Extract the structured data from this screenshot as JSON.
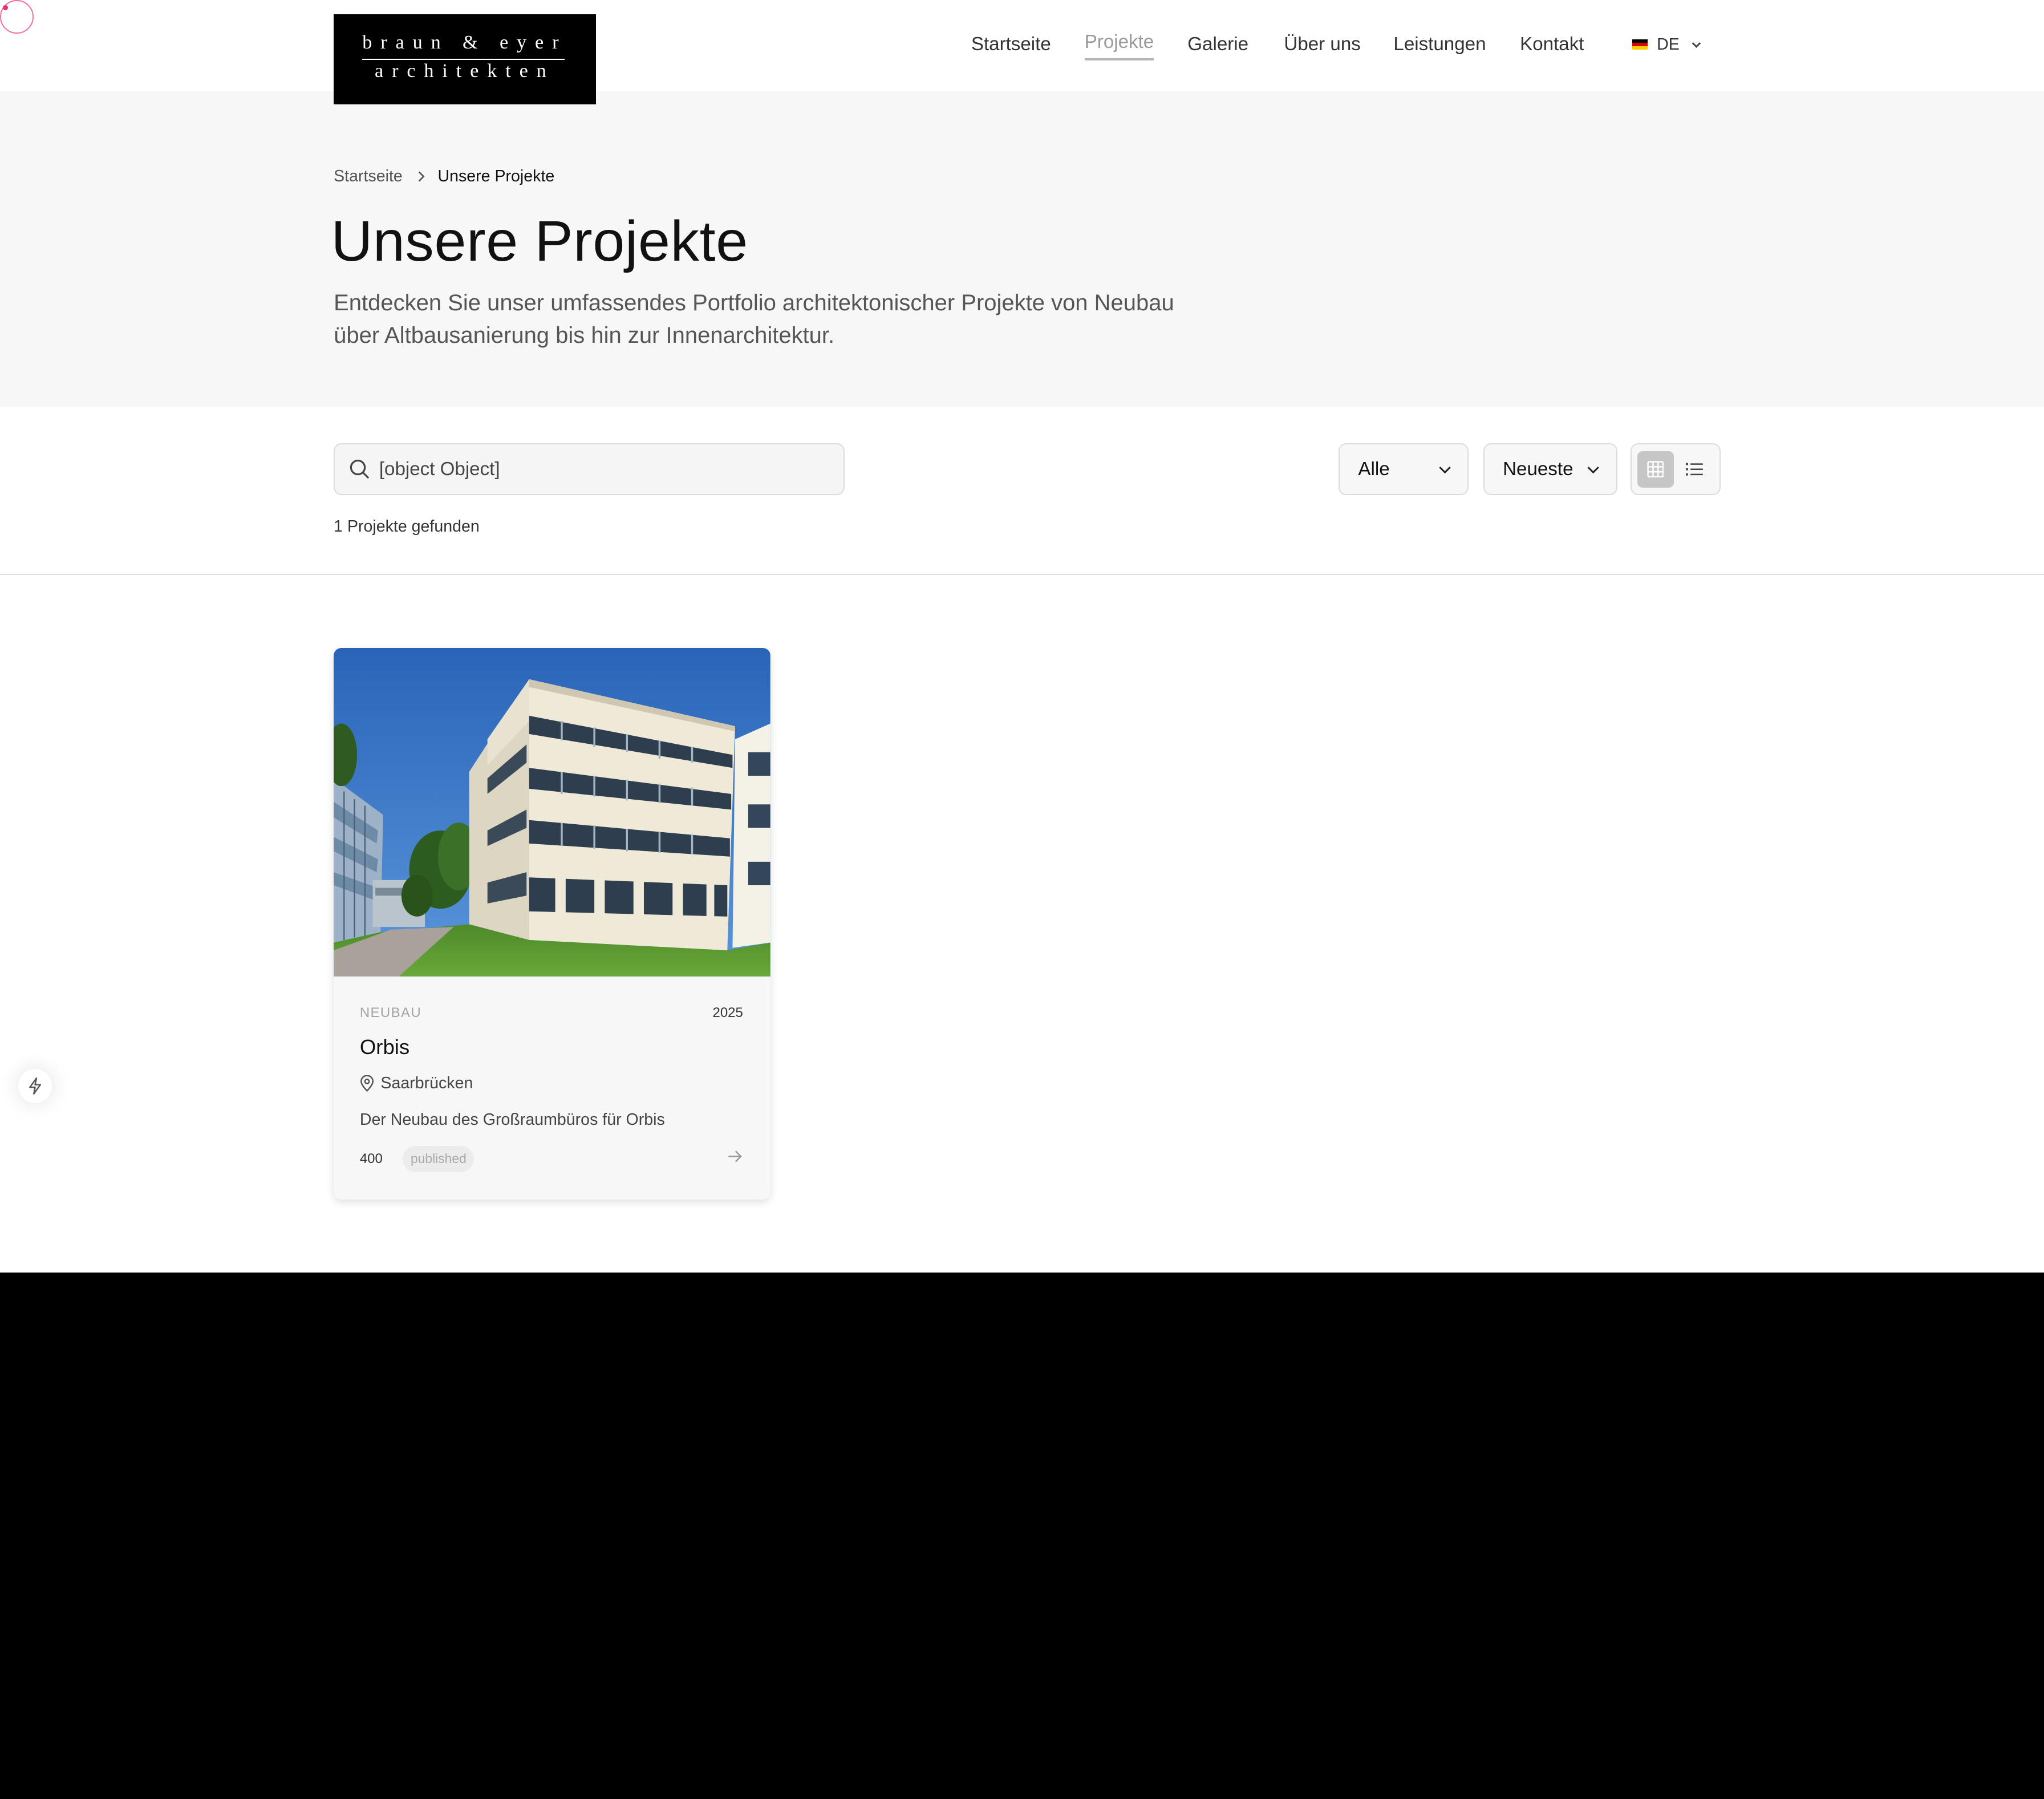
{
  "header": {
    "logo_line1": "braun & eyer",
    "logo_line2": "architekten",
    "nav": [
      "Startseite",
      "Projekte",
      "Galerie",
      "Über uns",
      "Leistungen",
      "Kontakt"
    ],
    "active_nav": "Projekte",
    "language": "DE",
    "language_flag": "flag-de-icon"
  },
  "breadcrumb": {
    "home": "Startseite",
    "current": "Unsere Projekte"
  },
  "hero": {
    "title": "Unsere Projekte",
    "lead": "Entdecken Sie unser umfassendes Portfolio architektonischer Projekte von Neubau über Altbausanierung bis hin zur Innenarchitektur."
  },
  "filters": {
    "search_value": "[object Object]",
    "category_selected": "Alle",
    "sort_selected": "Neueste",
    "view_mode": "grid",
    "result_count": "1 Projekte gefunden"
  },
  "projects": [
    {
      "category": "NEUBAU",
      "year": "2025",
      "title": "Orbis",
      "location": "Saarbrücken",
      "description": "Der Neubau des Großraumbüros für Orbis",
      "views": "400",
      "status": "published"
    }
  ],
  "colors": {
    "hero_bg": "#f7f7f7",
    "active_nav": "#9a9a9a",
    "cursor": "#e2336e"
  }
}
